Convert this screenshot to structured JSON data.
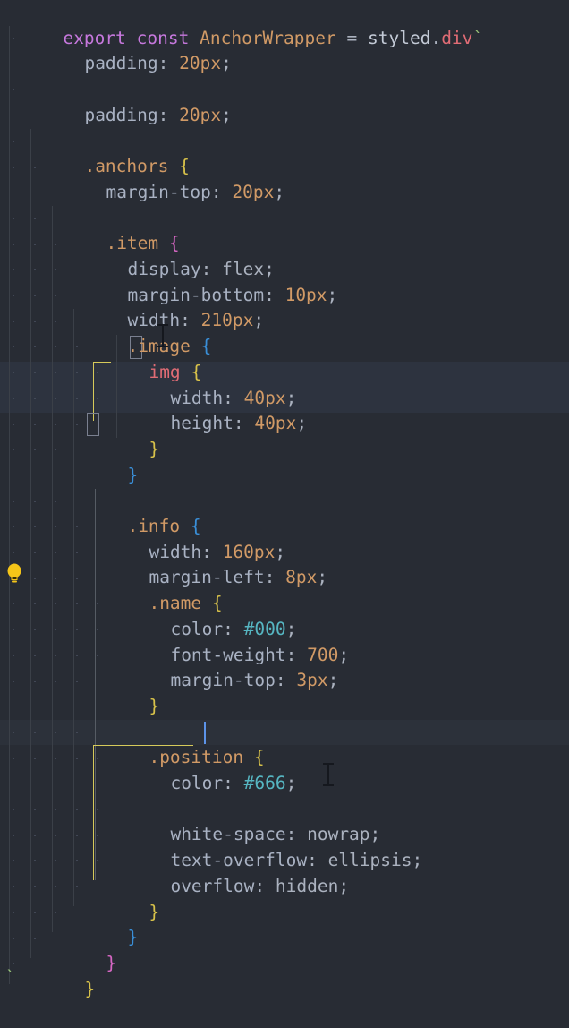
{
  "editor": {
    "language": "typescript-styled-components",
    "background_color": "#282c34",
    "font_size_px": 19.5,
    "line_height_px": 28.7,
    "theme": "One Dark"
  },
  "colors": {
    "keyword": "#c678dd",
    "identifier": "#d19a66",
    "selector": "#d19a66",
    "property": "#a9b2c3",
    "value": "#abb2bf",
    "number": "#d19a66",
    "hex_color": "#56b6c2",
    "tag": "#e06c75",
    "template_tick": "#98c379",
    "bracket_yellow": "#d8c24a",
    "bracket_blue": "#3a8fd8",
    "bracket_pink": "#d667c4",
    "indent_guide": "#3b4048",
    "indent_guide_active": "#565c64",
    "caret": "#5c93e8",
    "current_line": "#2c313a",
    "selection_band": "#2d333f"
  },
  "icons": {
    "lightbulb": "quick-fix-lightbulb",
    "mouse_cursor": "text-ibeam-cursor",
    "caret": "text-insertion-caret"
  },
  "code_lines": [
    {
      "n": 1,
      "text": "export const AnchorWrapper = styled.div`"
    },
    {
      "n": 2,
      "text": "  padding: 20px;"
    },
    {
      "n": 3,
      "text": ""
    },
    {
      "n": 4,
      "text": "  padding: 20px;"
    },
    {
      "n": 5,
      "text": ""
    },
    {
      "n": 6,
      "text": "  .anchors {"
    },
    {
      "n": 7,
      "text": "    margin-top: 20px;"
    },
    {
      "n": 8,
      "text": ""
    },
    {
      "n": 9,
      "text": "    .item {"
    },
    {
      "n": 10,
      "text": "      display: flex;"
    },
    {
      "n": 11,
      "text": "      margin-bottom: 10px;"
    },
    {
      "n": 12,
      "text": "      width: 210px;"
    },
    {
      "n": 13,
      "text": "      .image {"
    },
    {
      "n": 14,
      "text": "        img {"
    },
    {
      "n": 15,
      "text": "          width: 40px;"
    },
    {
      "n": 16,
      "text": "          height: 40px;"
    },
    {
      "n": 17,
      "text": "        }"
    },
    {
      "n": 18,
      "text": "      }"
    },
    {
      "n": 19,
      "text": ""
    },
    {
      "n": 20,
      "text": "      .info {"
    },
    {
      "n": 21,
      "text": "        width: 160px;"
    },
    {
      "n": 22,
      "text": "        margin-left: 8px;"
    },
    {
      "n": 23,
      "text": "        .name {"
    },
    {
      "n": 24,
      "text": "          color: #000;"
    },
    {
      "n": 25,
      "text": "          font-weight: 700;"
    },
    {
      "n": 26,
      "text": "          margin-top: 3px;"
    },
    {
      "n": 27,
      "text": "        }"
    },
    {
      "n": 28,
      "text": ""
    },
    {
      "n": 29,
      "text": "        .position {"
    },
    {
      "n": 30,
      "text": "          color: #666;"
    },
    {
      "n": 31,
      "text": ""
    },
    {
      "n": 32,
      "text": "          white-space: nowrap;"
    },
    {
      "n": 33,
      "text": "          text-overflow: ellipsis;"
    },
    {
      "n": 34,
      "text": "          overflow: hidden;"
    },
    {
      "n": 35,
      "text": "        }"
    },
    {
      "n": 36,
      "text": "      }"
    },
    {
      "n": 37,
      "text": "    }"
    },
    {
      "n": 38,
      "text": "  }"
    },
    {
      "n": 39,
      "text": "}"
    },
    {
      "n": 40,
      "text": "`"
    }
  ],
  "tokens": {
    "l1": {
      "export": "export",
      "const": "const",
      "name": "AnchorWrapper",
      "eq": "=",
      "styled": "styled",
      "dot": ".",
      "div": "div",
      "tick": "`"
    },
    "l2": {
      "prop": "padding",
      "colon": ":",
      "val": "20px",
      "semi": ";"
    },
    "l4": {
      "prop": "padding",
      "colon": ":",
      "val": "20px",
      "semi": ";"
    },
    "l6": {
      "sel": ".anchors",
      "brace": "{"
    },
    "l7": {
      "prop": "margin-top",
      "colon": ":",
      "val": "20px",
      "semi": ";"
    },
    "l9": {
      "sel": ".item",
      "brace": "{"
    },
    "l10": {
      "prop": "display",
      "colon": ":",
      "val": "flex",
      "semi": ";"
    },
    "l11": {
      "prop": "margin-bottom",
      "colon": ":",
      "val": "10px",
      "semi": ";"
    },
    "l12": {
      "prop": "width",
      "colon": ":",
      "val": "210px",
      "semi": ";"
    },
    "l13": {
      "sel": ".image",
      "brace": "{"
    },
    "l14": {
      "sel": "img",
      "brace": "{"
    },
    "l15": {
      "prop": "width",
      "colon": ":",
      "val": "40px",
      "semi": ";"
    },
    "l16": {
      "prop": "height",
      "colon": ":",
      "val": "40px",
      "semi": ";"
    },
    "l17": {
      "brace": "}"
    },
    "l18": {
      "brace": "}"
    },
    "l20": {
      "sel": ".info",
      "brace": "{"
    },
    "l21": {
      "prop": "width",
      "colon": ":",
      "val": "160px",
      "semi": ";"
    },
    "l22": {
      "prop": "margin-left",
      "colon": ":",
      "val": "8px",
      "semi": ";"
    },
    "l23": {
      "sel": ".name",
      "brace": "{"
    },
    "l24": {
      "prop": "color",
      "colon": ":",
      "val": "#000",
      "semi": ";"
    },
    "l25": {
      "prop": "font-weight",
      "colon": ":",
      "val": "700",
      "semi": ";"
    },
    "l26": {
      "prop": "margin-top",
      "colon": ":",
      "val": "3px",
      "semi": ";"
    },
    "l27": {
      "brace": "}"
    },
    "l29": {
      "sel": ".position",
      "brace": "{"
    },
    "l30": {
      "prop": "color",
      "colon": ":",
      "val": "#666",
      "semi": ";"
    },
    "l32": {
      "prop": "white-space",
      "colon": ":",
      "val": "nowrap",
      "semi": ";"
    },
    "l33": {
      "prop": "text-overflow",
      "colon": ":",
      "val": "ellipsis",
      "semi": ";"
    },
    "l34": {
      "prop": "overflow",
      "colon": ":",
      "val": "hidden",
      "semi": ";"
    },
    "l35": {
      "brace": "}"
    },
    "l36": {
      "brace": "}"
    },
    "l37": {
      "brace": "}"
    },
    "l38": {
      "brace": "}"
    },
    "l39": {
      "brace": "}"
    },
    "l40": {
      "tick": "`"
    }
  }
}
